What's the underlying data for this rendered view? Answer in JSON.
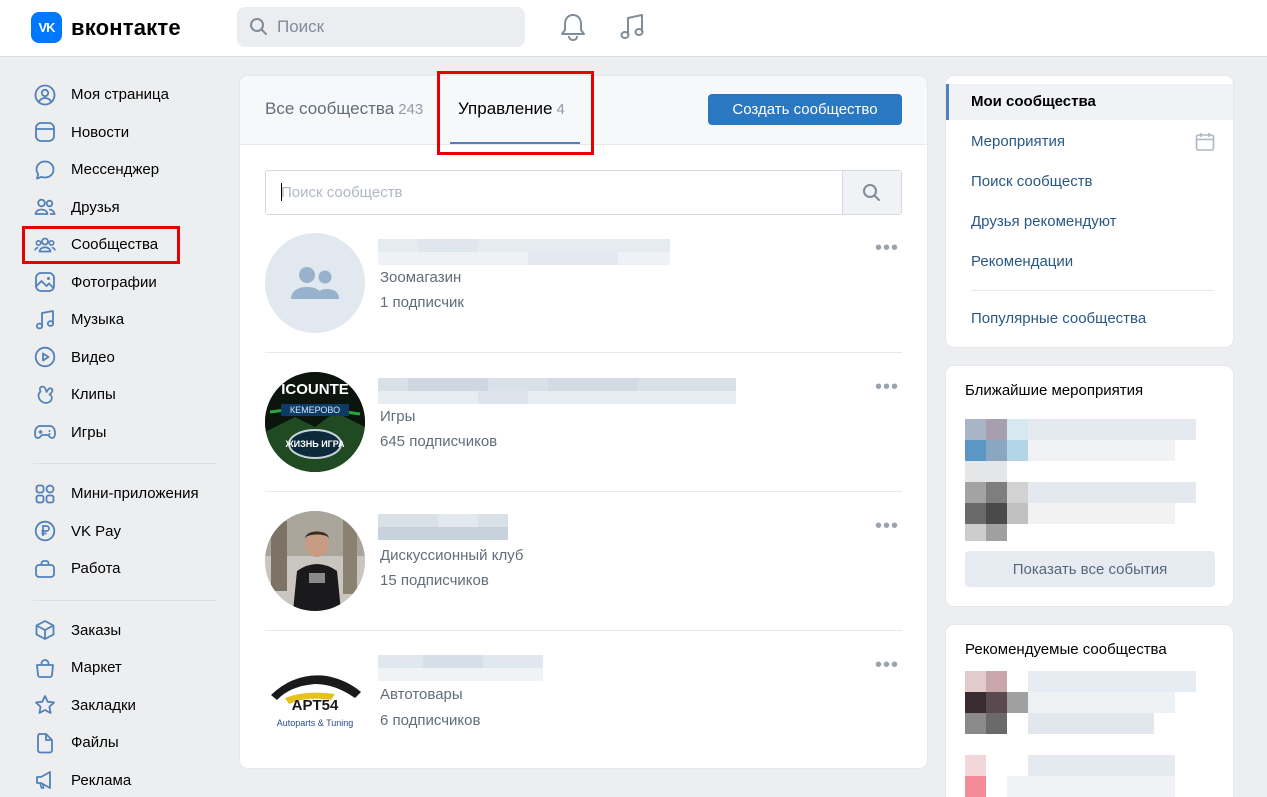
{
  "header": {
    "logo_text": "вконтакте",
    "logo_mark": "VK",
    "search_placeholder": "Поиск"
  },
  "left_nav": {
    "items": [
      {
        "label": "Моя страница",
        "icon": "user-circle-icon"
      },
      {
        "label": "Новости",
        "icon": "newsfeed-icon"
      },
      {
        "label": "Мессенджер",
        "icon": "message-icon"
      },
      {
        "label": "Друзья",
        "icon": "friends-icon"
      },
      {
        "label": "Сообщества",
        "icon": "communities-icon"
      },
      {
        "label": "Фотографии",
        "icon": "photo-icon"
      },
      {
        "label": "Музыка",
        "icon": "music-icon"
      },
      {
        "label": "Видео",
        "icon": "video-icon"
      },
      {
        "label": "Клипы",
        "icon": "clips-icon"
      },
      {
        "label": "Игры",
        "icon": "gamepad-icon"
      }
    ],
    "items2": [
      {
        "label": "Мини-приложения",
        "icon": "mini-apps-icon"
      },
      {
        "label": "VK Pay",
        "icon": "vkpay-icon"
      },
      {
        "label": "Работа",
        "icon": "work-icon"
      }
    ],
    "items3": [
      {
        "label": "Заказы",
        "icon": "orders-icon"
      },
      {
        "label": "Маркет",
        "icon": "market-icon"
      },
      {
        "label": "Закладки",
        "icon": "bookmark-icon"
      },
      {
        "label": "Файлы",
        "icon": "file-icon"
      },
      {
        "label": "Реклама",
        "icon": "ads-icon"
      }
    ]
  },
  "main": {
    "tabs": [
      {
        "label": "Все сообщества",
        "count": "243"
      },
      {
        "label": "Управление",
        "count": "4"
      }
    ],
    "create_button": "Создать сообщество",
    "search_placeholder": "Поиск сообществ",
    "groups": [
      {
        "category": "Зоомагазин",
        "subscribers": "1 подписчик"
      },
      {
        "category": "Игры",
        "subscribers": "645 подписчиков",
        "avatar_text_top": "ICOUNTE",
        "avatar_text_mid": "КЕМЕРОВО",
        "avatar_text_bottom": "ЖИЗНЬ ИГРА"
      },
      {
        "category": "Дискуссионный клуб",
        "subscribers": "15 подписчиков"
      },
      {
        "category": "Автотовары",
        "subscribers": "6 подписчиков",
        "avatar_text_top": "APT54",
        "avatar_text_bottom": "Autoparts & Tuning"
      }
    ],
    "more_glyph": "•••"
  },
  "right_menu": {
    "items": [
      {
        "label": "Мои сообщества"
      },
      {
        "label": "Мероприятия"
      },
      {
        "label": "Поиск сообществ"
      },
      {
        "label": "Друзья рекомендуют"
      },
      {
        "label": "Рекомендации"
      },
      {
        "label": "Популярные сообщества"
      }
    ]
  },
  "events_box": {
    "title": "Ближайшие мероприятия",
    "show_all": "Показать все события"
  },
  "recs_box": {
    "title": "Рекомендуемые сообщества"
  },
  "colors": {
    "accent": "#2a77c2",
    "link": "#2a5885",
    "highlight": "#e60000",
    "background": "#edeef0"
  }
}
